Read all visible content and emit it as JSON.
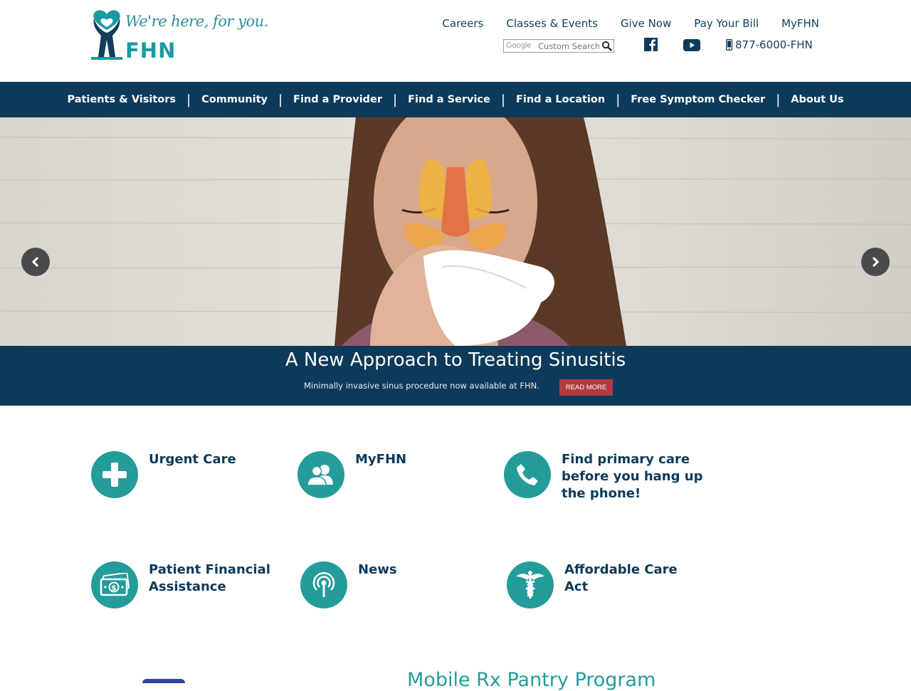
{
  "header": {
    "tagline": "We're here, for you.",
    "brand": "FHN",
    "util_nav": [
      "Careers",
      "Classes & Events",
      "Give Now",
      "Pay Your Bill",
      "MyFHN"
    ],
    "search": {
      "brand_label": "Google",
      "placeholder": "Custom Search"
    },
    "social": [
      "facebook-icon",
      "youtube-icon"
    ],
    "phone": "877-6000-FHN"
  },
  "main_nav": [
    "Patients & Visitors",
    "Community",
    "Find a Provider",
    "Find a Service",
    "Find a Location",
    "Free Symptom Checker",
    "About Us"
  ],
  "hero": {
    "title": "A New Approach to Treating Sinusitis",
    "subtitle": "Minimally invasive sinus procedure now available at FHN.",
    "button": "READ MORE"
  },
  "tiles": [
    {
      "label": "Urgent Care",
      "icon": "plus-icon"
    },
    {
      "label": "MyFHN",
      "icon": "users-icon"
    },
    {
      "label": "Find primary care before you hang up the phone!",
      "icon": "phone-icon"
    },
    {
      "label": "Patient Financial Assistance",
      "icon": "money-icon"
    },
    {
      "label": "News",
      "icon": "broadcast-icon"
    },
    {
      "label": "Affordable Care Act",
      "icon": "caduceus-icon"
    }
  ],
  "bottom": {
    "heading": "Mobile Rx Pantry Program"
  },
  "colors": {
    "navy": "#0d3a5b",
    "teal": "#239c9b",
    "button_red": "#b33a3f"
  }
}
